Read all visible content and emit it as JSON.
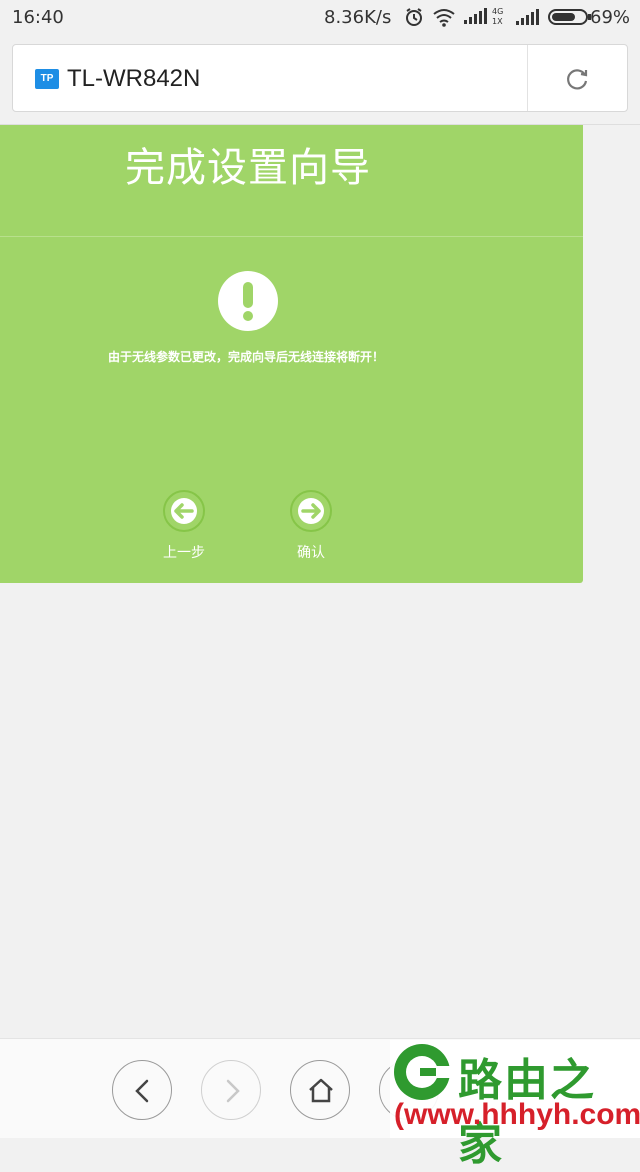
{
  "status_bar": {
    "time": "16:40",
    "net_speed": "8.36K/s",
    "battery": "69%"
  },
  "browser": {
    "site_badge": "TP",
    "address": "TL-WR842N"
  },
  "wizard": {
    "title": "完成设置向导",
    "message": "由于无线参数已更改，完成向导后无线连接将断开！",
    "prev_label": "上一步",
    "confirm_label": "确认"
  },
  "watermark": {
    "name": "路由之家",
    "url": "(www.hhhyh.com"
  },
  "colors": {
    "card_green": "#a0d568",
    "brand_blue": "#1e8ee5"
  }
}
